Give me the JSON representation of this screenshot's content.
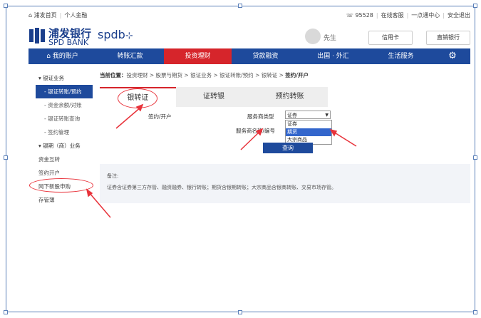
{
  "topbar": {
    "home": "浦发首页",
    "personal": "个人金融",
    "phone": "95528",
    "online_service": "在线客服",
    "one_stop": "一点通中心",
    "logout": "安全退出"
  },
  "header": {
    "logo_cn": "浦发银行",
    "logo_en": "SPD BANK",
    "spdb": "spdb",
    "username": "先生",
    "btn_credit": "信用卡",
    "btn_direct": "直销银行"
  },
  "nav": {
    "items": [
      "我的账户",
      "转账汇款",
      "投资理财",
      "贷款融资",
      "出国 · 外汇",
      "生活服务"
    ],
    "active": "投资理财"
  },
  "sidebar": {
    "items": [
      {
        "label": "银证业务",
        "type": "grp"
      },
      {
        "label": "银证转账/预约",
        "type": "sub active"
      },
      {
        "label": "资金余额/对账",
        "type": "sub"
      },
      {
        "label": "银证转账查询",
        "type": "sub"
      },
      {
        "label": "签约管理",
        "type": "sub"
      },
      {
        "label": "银期（商）业务",
        "type": "grp"
      },
      {
        "label": "资金互转",
        "type": "plain"
      },
      {
        "label": "签约开户",
        "type": "plain"
      },
      {
        "label": "网下新股申购",
        "type": "plain"
      },
      {
        "label": "存管薄",
        "type": "plain"
      }
    ]
  },
  "breadcrumb": {
    "label": "当前位置：",
    "path": "投资理财 > 股票与期货 > 银证业务 > 银证转账/预约 > 银转证 > ",
    "current": "签约/开户"
  },
  "tabs": [
    "银转证",
    "证转银",
    "预约转账"
  ],
  "form": {
    "left_label": "签约/开户",
    "type_label": "服务商类型",
    "name_label": "服务商名称/编号",
    "type_value": "证券",
    "options": [
      "证券",
      "期货",
      "大宗商品"
    ],
    "selected_option": "期货",
    "query_button": "查询"
  },
  "notes": {
    "title": "备注:",
    "text": "证券含证券第三方存管、融资融券、银行转账；期货含银期转账；大宗商品含银商转账、交易市场存管。"
  },
  "colors": {
    "brand_blue": "#1e4a9c",
    "nav_active_red": "#d6252b",
    "annotation_red": "#e8333b"
  }
}
